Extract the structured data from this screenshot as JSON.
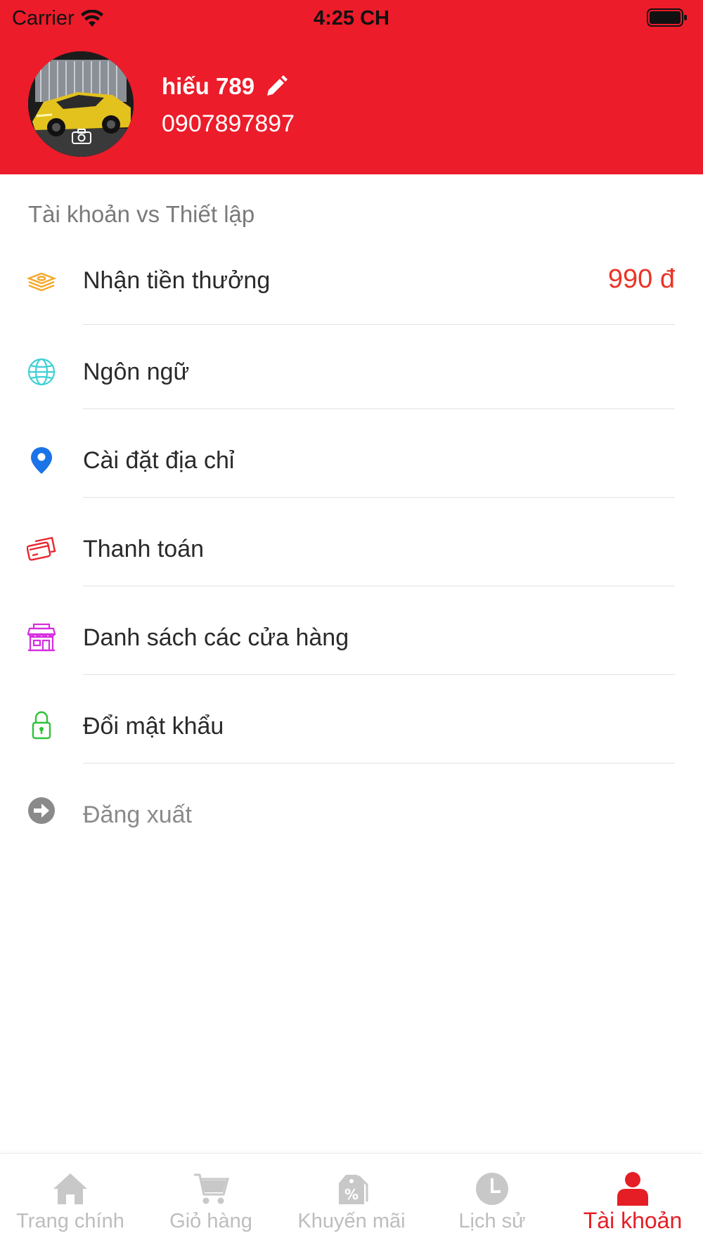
{
  "status_bar": {
    "carrier": "Carrier",
    "time": "4:25 CH"
  },
  "profile": {
    "name": "hiếu 789",
    "phone": "0907897897"
  },
  "settings": {
    "section_title": "Tài khoản vs Thiết lập",
    "items": [
      {
        "label": "Nhận tiền thưởng",
        "value": "990 đ",
        "icon": "money-stack-icon",
        "icon_color": "#f5a623"
      },
      {
        "label": "Ngôn ngữ",
        "icon": "globe-icon",
        "icon_color": "#3fd0d8"
      },
      {
        "label": "Cài đặt địa chỉ",
        "icon": "location-pin-icon",
        "icon_color": "#1a73e8"
      },
      {
        "label": "Thanh toán",
        "icon": "credit-card-icon",
        "icon_color": "#e8262f"
      },
      {
        "label": "Danh sách các cửa hàng",
        "icon": "store-icon",
        "icon_color": "#d62be0"
      },
      {
        "label": "Đổi mật khẩu",
        "icon": "lock-icon",
        "icon_color": "#2fc23a"
      },
      {
        "label": "Đăng xuất",
        "icon": "logout-arrow-icon",
        "icon_color": "#8a8a8a"
      }
    ]
  },
  "tabbar": {
    "tabs": [
      {
        "label": "Trang chính",
        "icon": "home-icon"
      },
      {
        "label": "Giỏ hàng",
        "icon": "cart-icon"
      },
      {
        "label": "Khuyến mãi",
        "icon": "discount-tag-icon"
      },
      {
        "label": "Lịch sử",
        "icon": "clock-icon"
      },
      {
        "label": "Tài khoản",
        "icon": "user-icon",
        "active": true
      }
    ],
    "active_color": "#e51e25",
    "inactive_color": "#bdbdbd"
  },
  "colors": {
    "header_bg": "#ec1c2a",
    "bonus_value": "#ec3325"
  }
}
